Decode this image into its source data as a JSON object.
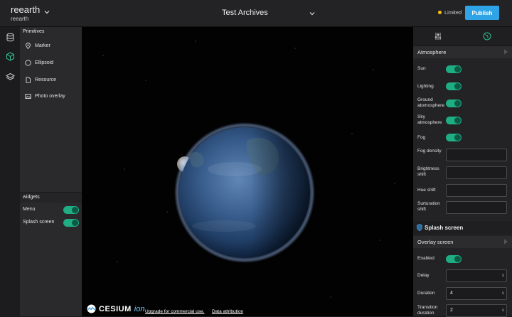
{
  "header": {
    "brand_name": "reearth",
    "brand_sub": "reearth",
    "project_title": "Test Archives",
    "plan_label": "Limited",
    "publish_label": "Publish"
  },
  "left_panel": {
    "primitives_title": "Primitives",
    "primitives": [
      {
        "label": "Marker",
        "icon": "marker-icon"
      },
      {
        "label": "Ellipsoid",
        "icon": "ellipsoid-icon"
      },
      {
        "label": "Resource",
        "icon": "resource-icon"
      },
      {
        "label": "Photo overlay",
        "icon": "photo-overlay-icon"
      }
    ],
    "widgets_title": "widgets",
    "widgets": [
      {
        "label": "Menu",
        "enabled": true
      },
      {
        "label": "Splash screen",
        "enabled": true
      }
    ]
  },
  "viewer": {
    "logo_text": "CESIUM",
    "logo_suffix": "ion",
    "upgrade_link": "Upgrade for commercial use.",
    "attribution_link": "Data attribution"
  },
  "right_panel": {
    "atmosphere_title": "Atmosphere",
    "atmosphere": {
      "sun": "Sun",
      "lighting": "Lighting",
      "ground": "Ground atomosphere",
      "sky": "Sky atmosphere",
      "fog": "Fog",
      "fog_density": "Fog density",
      "brightness_shift": "Brightness shift",
      "hue_shift": "Hue shift",
      "saturation_shift": "Surturation shift"
    },
    "splash_title": "Splash screen",
    "overlay_title": "Overlay screen",
    "overlay": {
      "enabled": "Enabled",
      "delay": "Delay",
      "delay_unit": "s",
      "duration": "Duration",
      "duration_value": "4",
      "duration_unit": "s",
      "transition": "Transition duration",
      "transition_value": "2",
      "transition_unit": "s"
    }
  },
  "colors": {
    "accent": "#2ea3e6",
    "toggle_on": "#1fae84",
    "plan_dot": "#f5c518"
  }
}
